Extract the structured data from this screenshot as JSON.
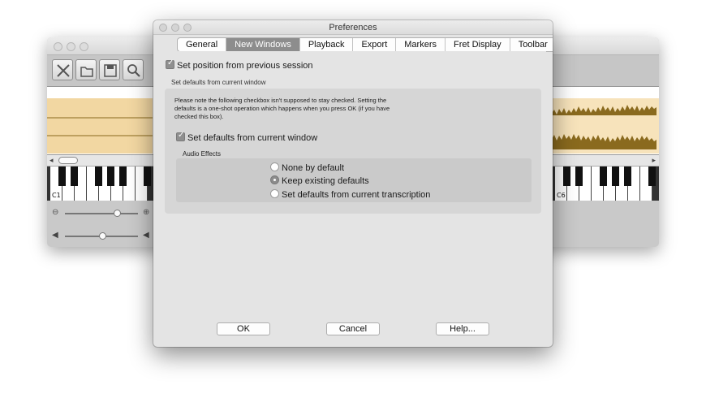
{
  "background_window": {
    "toolbar_icons": [
      "close-x-icon",
      "open-icon",
      "save-icon",
      "search-icon"
    ],
    "key_labels": {
      "left": "C1",
      "right": "C6"
    }
  },
  "dialog": {
    "title": "Preferences",
    "tabs": [
      {
        "label": "General",
        "selected": false
      },
      {
        "label": "New Windows",
        "selected": true
      },
      {
        "label": "Playback",
        "selected": false
      },
      {
        "label": "Export",
        "selected": false
      },
      {
        "label": "Markers",
        "selected": false
      },
      {
        "label": "Fret Display",
        "selected": false
      },
      {
        "label": "Toolbar",
        "selected": false
      }
    ],
    "set_position_checkbox": {
      "label": "Set position from previous session",
      "checked": true
    },
    "section_caption": "Set defaults from current window",
    "note": "Please note the following checkbox isn't supposed to stay checked. Setting the defaults is a one-shot operation which happens when you press OK (if you have checked this box).",
    "set_defaults_checkbox": {
      "label": "Set defaults from current window",
      "checked": true
    },
    "audio_effects": {
      "caption": "Audio Effects",
      "options": [
        {
          "label": "None by default",
          "selected": false
        },
        {
          "label": "Keep existing defaults",
          "selected": true
        },
        {
          "label": "Set defaults from current transcription",
          "selected": false
        }
      ]
    },
    "buttons": {
      "ok": "OK",
      "cancel": "Cancel",
      "help": "Help..."
    }
  },
  "colors": {
    "selected_tab": "#8d8d8d",
    "waveform": "#8a6a1e",
    "waveform_bg": "#f2d7a2"
  }
}
